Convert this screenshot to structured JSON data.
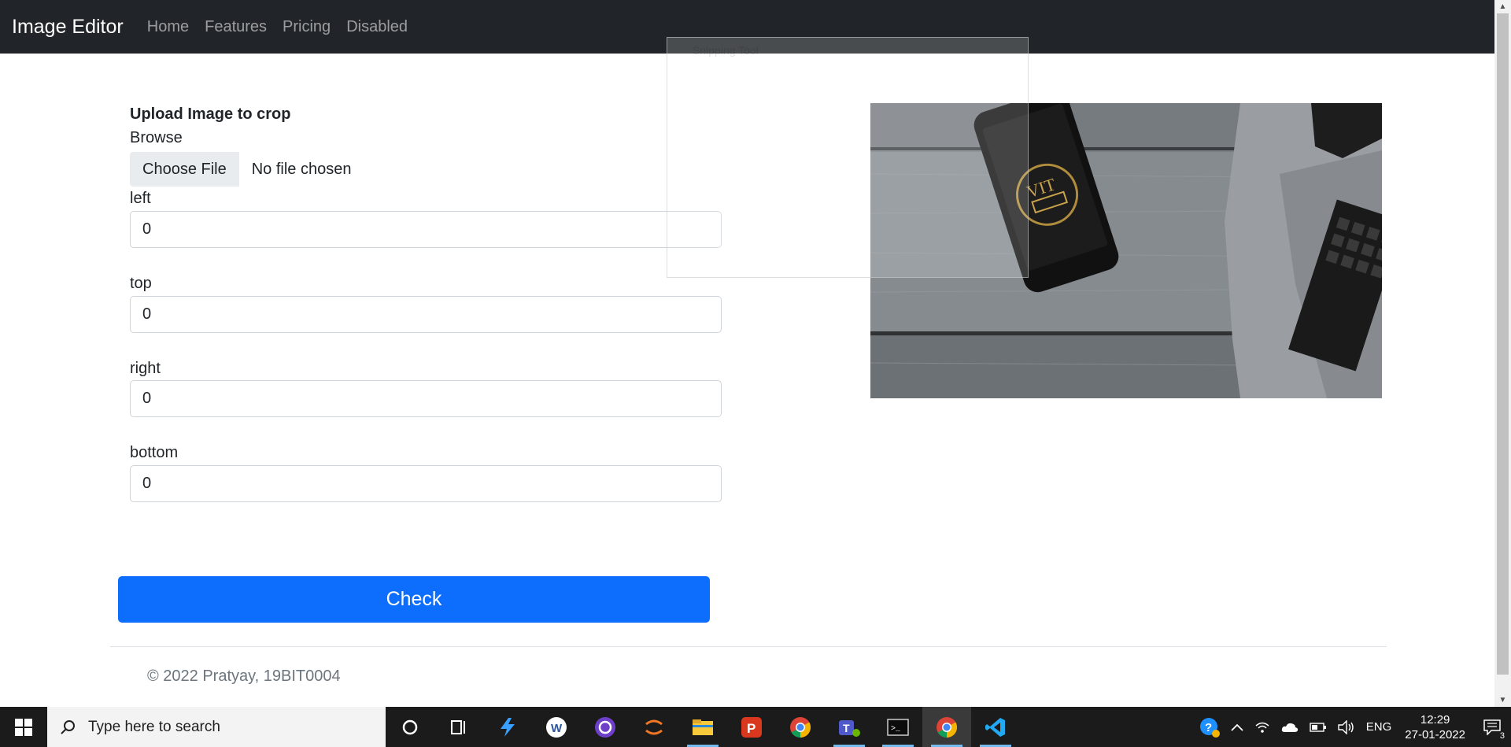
{
  "navbar": {
    "brand": "Image Editor",
    "links": [
      "Home",
      "Features",
      "Pricing",
      "Disabled"
    ]
  },
  "form": {
    "title": "Upload Image to crop",
    "browse_label": "Browse",
    "file_button": "Choose File",
    "file_status": "No file chosen",
    "fields": [
      {
        "label": "left",
        "value": "0"
      },
      {
        "label": "top",
        "value": "0"
      },
      {
        "label": "right",
        "value": "0"
      },
      {
        "label": "bottom",
        "value": "0"
      }
    ],
    "submit": "Check"
  },
  "overlay": {
    "title": "Snipping Tool"
  },
  "photo": {
    "logo_text": "VIT"
  },
  "footer": {
    "text": "© 2022 Pratyay, 19BIT0004"
  },
  "taskbar": {
    "search_placeholder": "Type here to search",
    "language": "ENG",
    "time": "12:29",
    "date": "27-01-2022",
    "notifications": "3",
    "accent": "#0d6efd"
  }
}
